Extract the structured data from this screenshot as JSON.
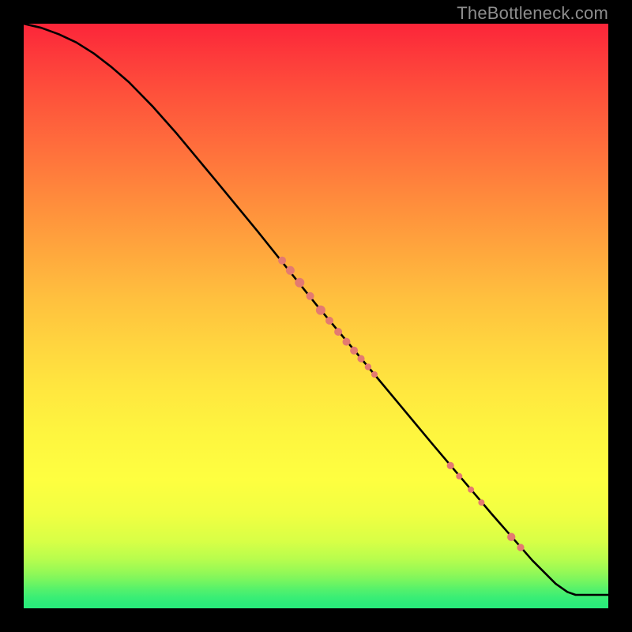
{
  "watermark": "TheBottleneck.com",
  "chart_data": {
    "type": "line",
    "title": "",
    "xlabel": "",
    "ylabel": "",
    "xlim": [
      0,
      100
    ],
    "ylim": [
      0,
      100
    ],
    "curve": [
      {
        "x": 0.0,
        "y": 100.0
      },
      {
        "x": 3.0,
        "y": 99.3
      },
      {
        "x": 6.0,
        "y": 98.2
      },
      {
        "x": 9.0,
        "y": 96.8
      },
      {
        "x": 12.0,
        "y": 94.9
      },
      {
        "x": 15.0,
        "y": 92.6
      },
      {
        "x": 18.0,
        "y": 90.0
      },
      {
        "x": 22.0,
        "y": 85.9
      },
      {
        "x": 26.0,
        "y": 81.4
      },
      {
        "x": 33.0,
        "y": 73.0
      },
      {
        "x": 40.0,
        "y": 64.5
      },
      {
        "x": 50.0,
        "y": 52.0
      },
      {
        "x": 60.0,
        "y": 40.0
      },
      {
        "x": 70.0,
        "y": 28.0
      },
      {
        "x": 80.0,
        "y": 16.2
      },
      {
        "x": 87.0,
        "y": 8.2
      },
      {
        "x": 91.0,
        "y": 4.2
      },
      {
        "x": 93.0,
        "y": 2.8
      },
      {
        "x": 94.4,
        "y": 2.3
      },
      {
        "x": 100.0,
        "y": 2.3
      }
    ],
    "clusters": [
      {
        "x": 44.2,
        "y": 59.5,
        "r": 5.0
      },
      {
        "x": 45.6,
        "y": 57.8,
        "r": 5.5
      },
      {
        "x": 47.2,
        "y": 55.7,
        "r": 6.0
      },
      {
        "x": 49.0,
        "y": 53.4,
        "r": 5.0
      },
      {
        "x": 50.8,
        "y": 51.0,
        "r": 6.0
      },
      {
        "x": 52.3,
        "y": 49.2,
        "r": 5.0
      },
      {
        "x": 53.8,
        "y": 47.3,
        "r": 5.0
      },
      {
        "x": 55.2,
        "y": 45.6,
        "r": 5.0
      },
      {
        "x": 56.5,
        "y": 44.1,
        "r": 5.0
      },
      {
        "x": 57.7,
        "y": 42.7,
        "r": 4.6
      },
      {
        "x": 58.9,
        "y": 41.3,
        "r": 4.2
      },
      {
        "x": 60.0,
        "y": 40.0,
        "r": 4.0
      },
      {
        "x": 73.0,
        "y": 24.4,
        "r": 4.6
      },
      {
        "x": 74.5,
        "y": 22.6,
        "r": 4.0
      },
      {
        "x": 76.5,
        "y": 20.3,
        "r": 4.0
      },
      {
        "x": 78.3,
        "y": 18.1,
        "r": 4.0
      },
      {
        "x": 83.4,
        "y": 12.2,
        "r": 5.2
      },
      {
        "x": 85.0,
        "y": 10.4,
        "r": 4.6
      }
    ],
    "colors": {
      "curve": "#000000",
      "dots": "#e47a70",
      "gradient_top": "#fc2539",
      "gradient_mid": "#feff40",
      "gradient_bottom": "#28ec7b"
    }
  }
}
